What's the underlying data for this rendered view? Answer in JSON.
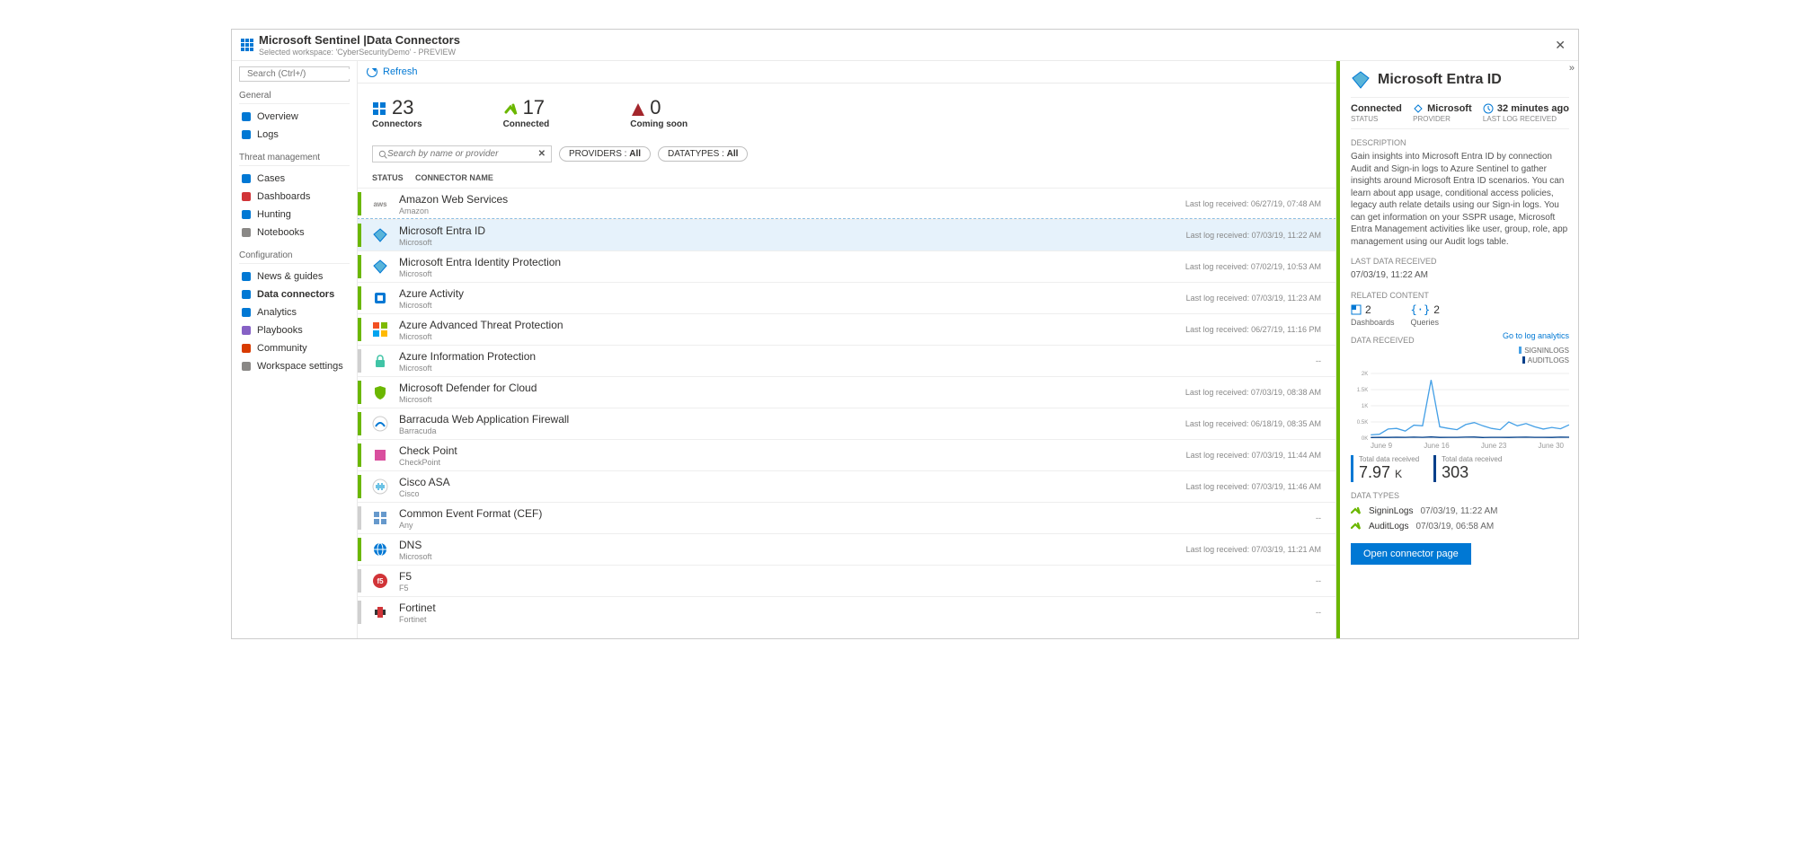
{
  "header": {
    "title": "Microsoft Sentinel |Data Connectors",
    "subtitle": "Selected workspace: 'CyberSecurityDemo' - PREVIEW"
  },
  "search": {
    "placeholder": "Search (Ctrl+/)"
  },
  "sidebar": {
    "sections": [
      {
        "label": "General",
        "items": [
          {
            "icon": "shield-icon",
            "label": "Overview",
            "color": "#0078d4"
          },
          {
            "icon": "logs-icon",
            "label": "Logs",
            "color": "#0078d4"
          }
        ]
      },
      {
        "label": "Threat management",
        "items": [
          {
            "icon": "folder-icon",
            "label": "Cases",
            "color": "#0078d4"
          },
          {
            "icon": "dashboard-icon",
            "label": "Dashboards",
            "color": "#d13438"
          },
          {
            "icon": "target-icon",
            "label": "Hunting",
            "color": "#0078d4"
          },
          {
            "icon": "notebook-icon",
            "label": "Notebooks",
            "color": "#8a8886"
          }
        ]
      },
      {
        "label": "Configuration",
        "items": [
          {
            "icon": "news-icon",
            "label": "News & guides",
            "color": "#0078d4"
          },
          {
            "icon": "grid-icon",
            "label": "Data connectors",
            "color": "#0078d4",
            "active": true
          },
          {
            "icon": "analytics-icon",
            "label": "Analytics",
            "color": "#0078d4"
          },
          {
            "icon": "playbook-icon",
            "label": "Playbooks",
            "color": "#8661c5"
          },
          {
            "icon": "community-icon",
            "label": "Community",
            "color": "#d83b01"
          },
          {
            "icon": "gear-icon",
            "label": "Workspace settings",
            "color": "#8a8886"
          }
        ]
      }
    ]
  },
  "toolbar": {
    "refresh": "Refresh"
  },
  "stats": {
    "connectors": {
      "value": "23",
      "label": "Connectors"
    },
    "connected": {
      "value": "17",
      "label": "Connected"
    },
    "coming": {
      "value": "0",
      "label": "Coming soon"
    }
  },
  "filters": {
    "search_placeholder": "Search by name or provider",
    "providers_label": "PROVIDERS : ",
    "providers_value": "All",
    "datatypes_label": "DATATYPES : ",
    "datatypes_value": "All"
  },
  "list_headers": {
    "status": "STATUS",
    "name": "CONNECTOR NAME"
  },
  "connectors": [
    {
      "name": "Amazon Web Services",
      "provider": "Amazon",
      "status": "connected",
      "lastlog": "Last log received: 06/27/19, 07:48 AM",
      "icon": "aws"
    },
    {
      "name": "Microsoft Entra ID",
      "provider": "Microsoft",
      "status": "connected",
      "lastlog": "Last log received: 07/03/19, 11:22 AM",
      "icon": "azuread",
      "selected": true
    },
    {
      "name": "Microsoft Entra Identity Protection",
      "provider": "Microsoft",
      "status": "connected",
      "lastlog": "Last log received: 07/02/19, 10:53 AM",
      "icon": "azuread"
    },
    {
      "name": "Azure Activity",
      "provider": "Microsoft",
      "status": "connected",
      "lastlog": "Last log received: 07/03/19, 11:23 AM",
      "icon": "activity"
    },
    {
      "name": "Azure Advanced Threat Protection",
      "provider": "Microsoft",
      "status": "connected",
      "lastlog": "Last log received: 06/27/19, 11:16 PM",
      "icon": "mslogo"
    },
    {
      "name": "Azure Information Protection",
      "provider": "Microsoft",
      "status": "notconn",
      "lastlog": "--",
      "icon": "lock"
    },
    {
      "name": "Microsoft Defender for Cloud",
      "provider": "Microsoft",
      "status": "connected",
      "lastlog": "Last log received: 07/03/19, 08:38 AM",
      "icon": "shield"
    },
    {
      "name": "Barracuda Web Application Firewall",
      "provider": "Barracuda",
      "status": "connected",
      "lastlog": "Last log received: 06/18/19, 08:35 AM",
      "icon": "barracuda"
    },
    {
      "name": "Check Point",
      "provider": "CheckPoint",
      "status": "connected",
      "lastlog": "Last log received: 07/03/19, 11:44 AM",
      "icon": "checkpoint"
    },
    {
      "name": "Cisco ASA",
      "provider": "Cisco",
      "status": "connected",
      "lastlog": "Last log received: 07/03/19, 11:46 AM",
      "icon": "cisco"
    },
    {
      "name": "Common Event Format (CEF)",
      "provider": "Any",
      "status": "notconn",
      "lastlog": "--",
      "icon": "cef"
    },
    {
      "name": "DNS",
      "provider": "Microsoft",
      "status": "connected",
      "lastlog": "Last log received: 07/03/19, 11:21 AM",
      "icon": "dns"
    },
    {
      "name": "F5",
      "provider": "F5",
      "status": "notconn",
      "lastlog": "--",
      "icon": "f5"
    },
    {
      "name": "Fortinet",
      "provider": "Fortinet",
      "status": "notconn",
      "lastlog": "--",
      "icon": "fortinet"
    }
  ],
  "detail": {
    "title": "Microsoft Entra ID",
    "connected": "Connected",
    "status_lbl": "STATUS",
    "provider": "Microsoft",
    "provider_lbl": "PROVIDER",
    "lastlog": "32 minutes ago",
    "lastlog_lbl": "LAST LOG RECEIVED",
    "desc_lbl": "DESCRIPTION",
    "desc": "Gain insights into Microsoft Entra ID by connection Audit and Sign-in logs to Azure Sentinel to gather insights around Microsoft Entra ID scenarios. You can learn about app usage, conditional access policies, legacy auth relate details using our Sign-in logs. You can get information on your SSPR usage, Microsoft Entra Management activities like user, group, role, app management using our Audit logs table.",
    "ldr_lbl": "LAST DATA RECEIVED",
    "ldr_val": "07/03/19, 11:22 AM",
    "related_lbl": "RELATED CONTENT",
    "related": {
      "dashboards_count": "2",
      "dashboards_label": "Dashboards",
      "queries_count": "2",
      "queries_label": "Queries"
    },
    "datarecv_lbl": "DATA RECEIVED",
    "chart_link": "Go to log analytics",
    "legend": {
      "s1": "SIGNINLOGS",
      "s2": "AUDITLOGS"
    },
    "totals": {
      "t1_lbl": "Total data received",
      "t1_val": "7.97",
      "t1_suffix": "K",
      "t2_lbl": "Total data received",
      "t2_val": "303"
    },
    "datatypes_lbl": "DATA TYPES",
    "datatypes": [
      {
        "name": "SigninLogs",
        "ts": "07/03/19, 11:22 AM"
      },
      {
        "name": "AuditLogs",
        "ts": "07/03/19, 06:58 AM"
      }
    ],
    "button": "Open connector page"
  },
  "chart_data": {
    "type": "line",
    "x": [
      "June 9",
      "June 16",
      "June 23",
      "June 30"
    ],
    "ylim": [
      0,
      2000
    ],
    "yticks": [
      "0K",
      "0.5K",
      "1K",
      "1.5K",
      "2K"
    ],
    "series": [
      {
        "name": "SIGNINLOGS",
        "color": "#45a0e6",
        "values": [
          100,
          120,
          280,
          300,
          220,
          400,
          380,
          1800,
          350,
          300,
          260,
          420,
          480,
          380,
          300,
          260,
          500,
          380,
          450,
          350,
          280,
          330,
          290,
          410
        ]
      },
      {
        "name": "AUDITLOGS",
        "color": "#003f8a",
        "values": [
          20,
          25,
          22,
          28,
          24,
          30,
          26,
          35,
          22,
          24,
          26,
          30,
          32,
          20,
          24,
          26,
          22,
          28,
          30,
          24,
          26,
          22,
          30,
          28
        ]
      }
    ]
  }
}
